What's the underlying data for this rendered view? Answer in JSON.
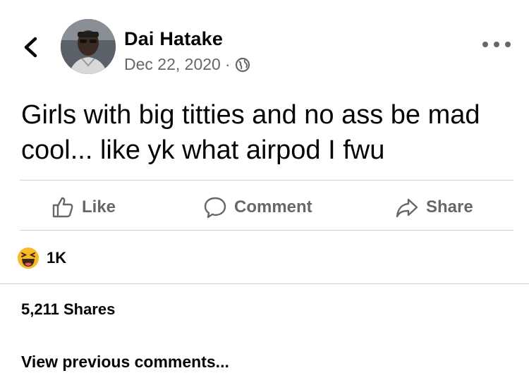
{
  "post": {
    "author": "Dai Hatake",
    "date": "Dec 22, 2020",
    "separator": "·",
    "audience_icon": "globe-icon",
    "text": "Girls with big titties and no ass be mad cool... like yk what airpod I fwu"
  },
  "actions": {
    "like": "Like",
    "comment": "Comment",
    "share": "Share"
  },
  "reactions": {
    "icon": "haha-emoji-icon",
    "count": "1K"
  },
  "shares_label": "5,211 Shares",
  "view_previous": "View previous comments...",
  "colors": {
    "text": "#050505",
    "secondary": "#65676b",
    "divider": "#ced0d4",
    "reaction": "#f7b928"
  }
}
